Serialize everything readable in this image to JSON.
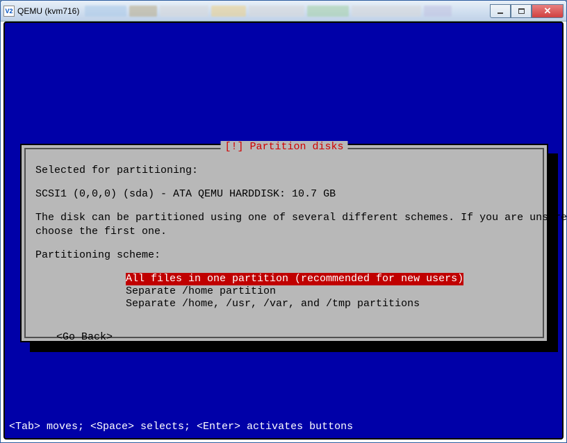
{
  "window": {
    "title": "QEMU (kvm716)",
    "icon_label": "V2"
  },
  "dialog": {
    "title": "[!] Partition disks",
    "selected_label": "Selected for partitioning:",
    "disk_info": "SCSI1 (0,0,0) (sda) - ATA QEMU HARDDISK: 10.7 GB",
    "instruction_l1": "The disk can be partitioned using one of several different schemes. If you are unsure,",
    "instruction_l2": "choose the first one.",
    "scheme_label": "Partitioning scheme:",
    "options": [
      "All files in one partition (recommended for new users)",
      "Separate /home partition",
      "Separate /home, /usr, /var, and /tmp partitions"
    ],
    "go_back": "<Go Back>"
  },
  "footer": "<Tab> moves; <Space> selects; <Enter> activates buttons"
}
